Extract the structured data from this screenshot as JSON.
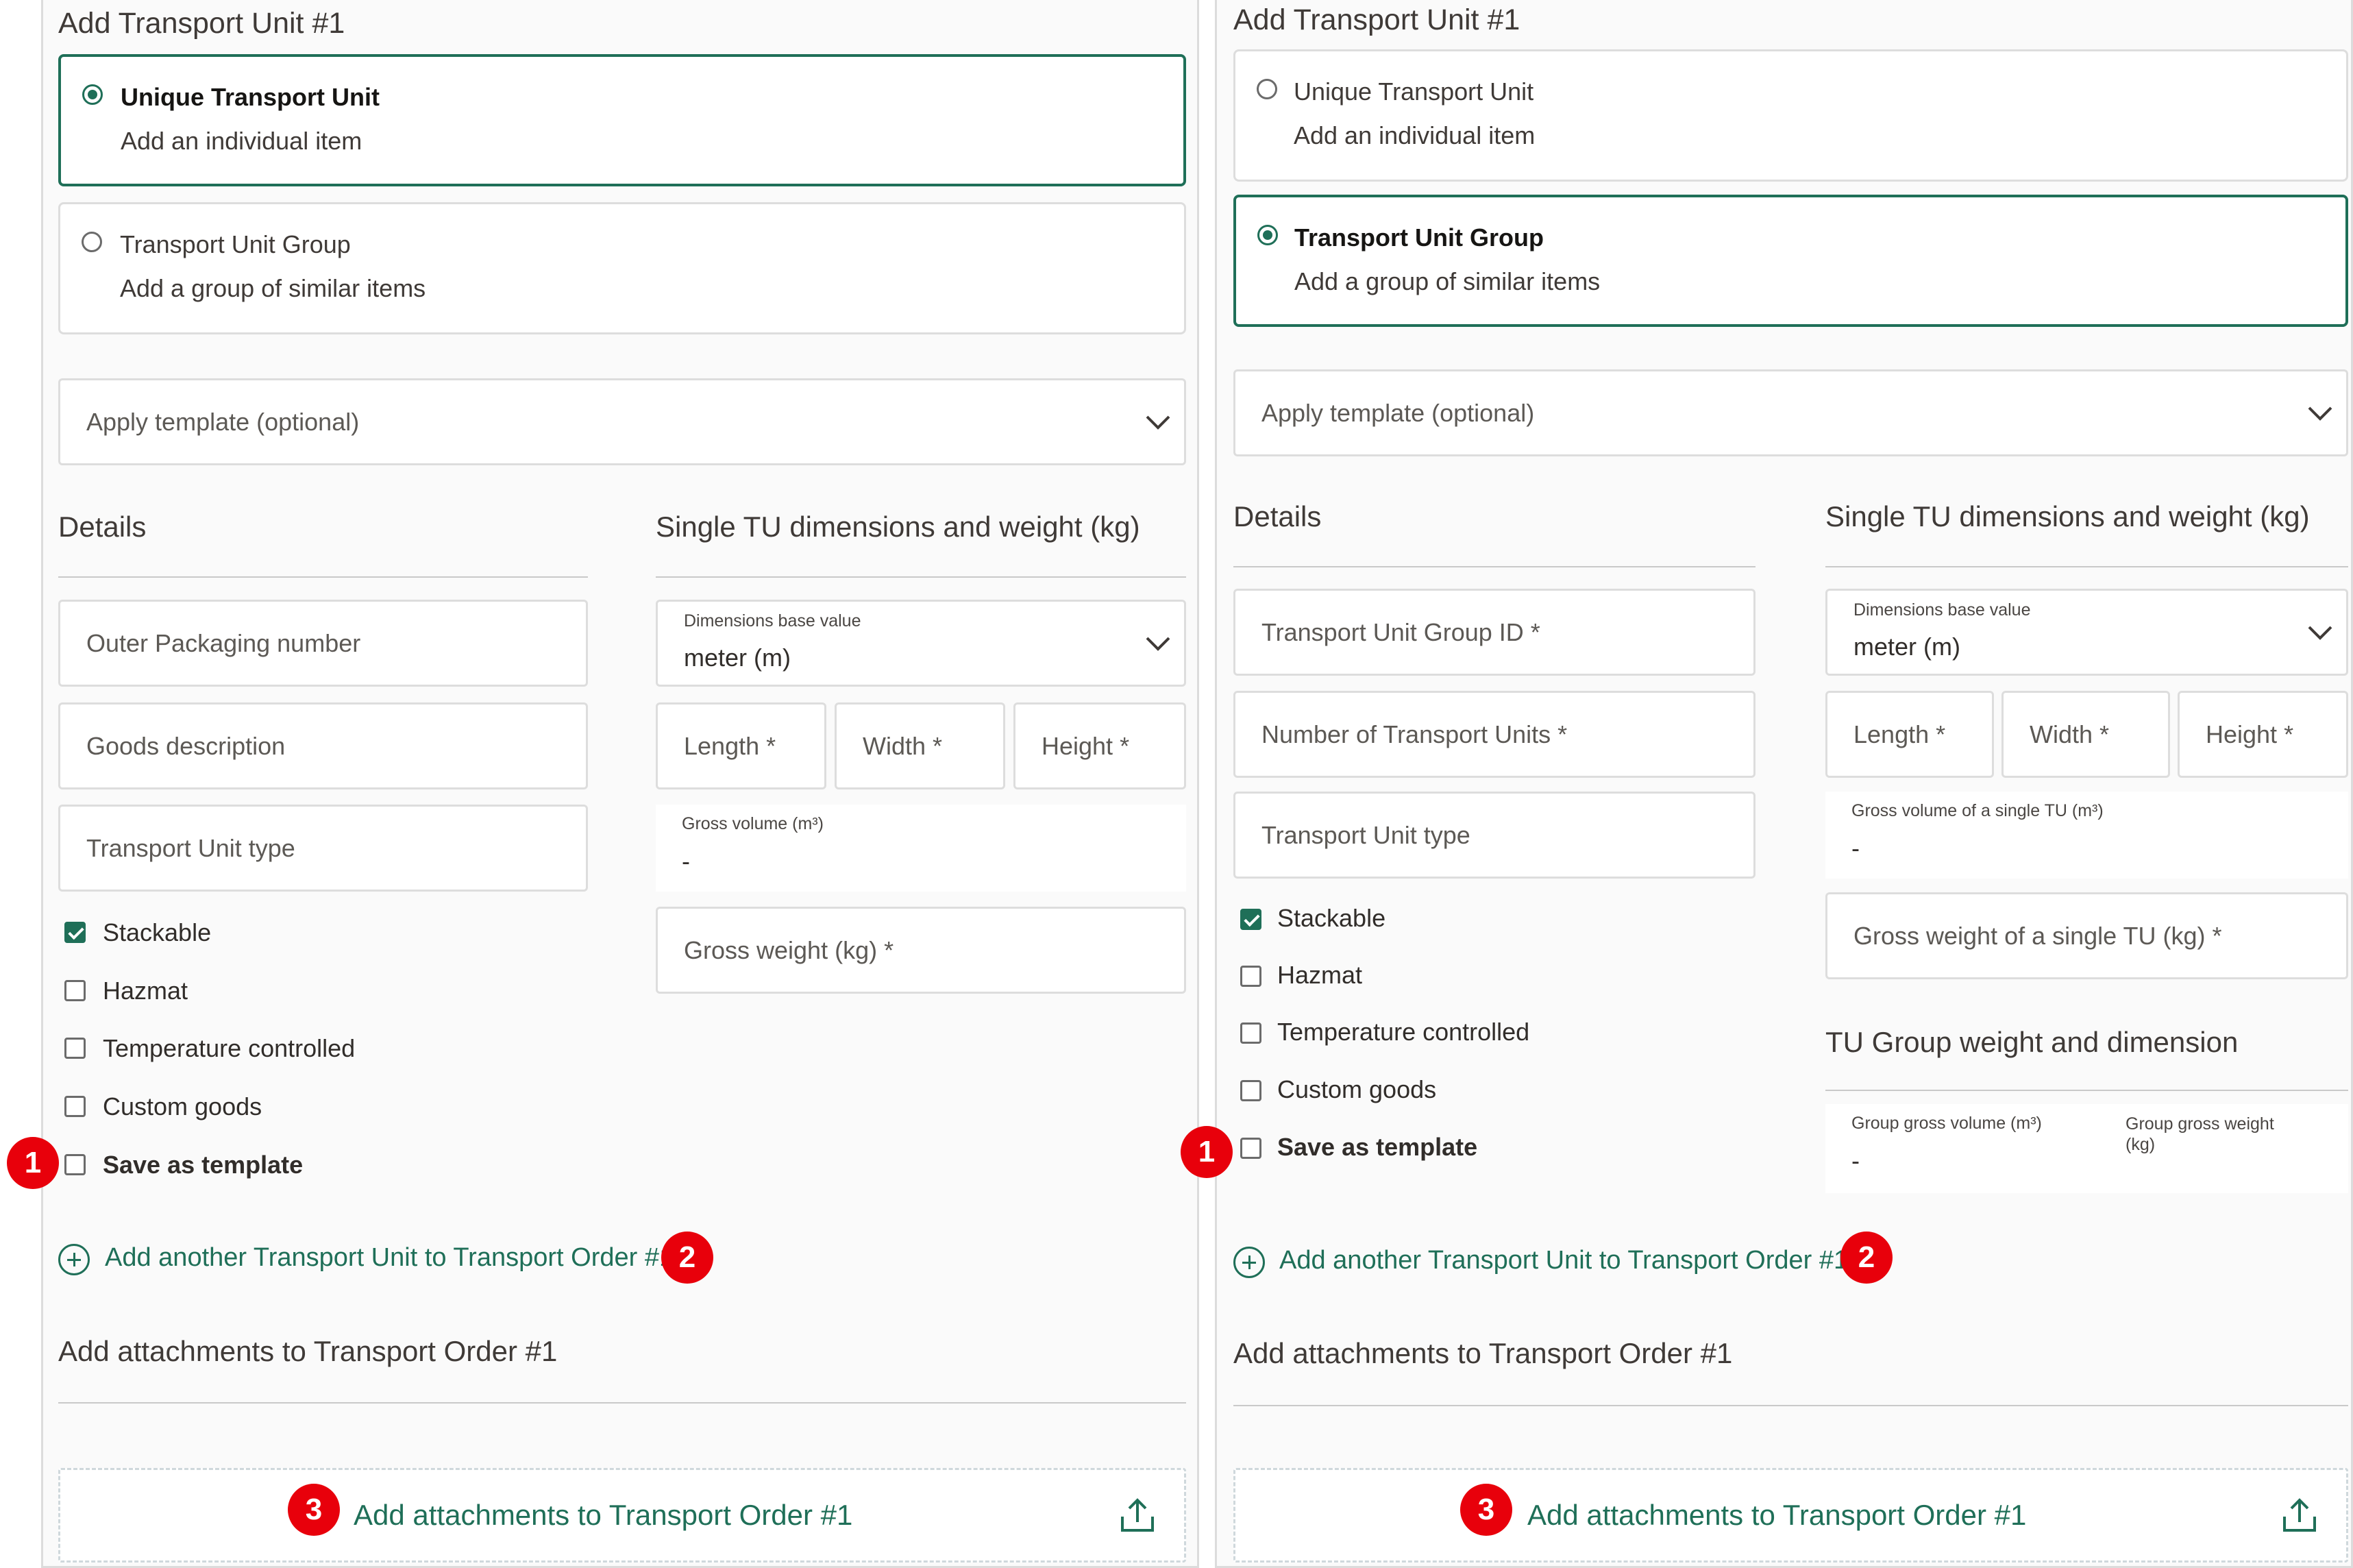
{
  "colors": {
    "accent": "#1f6f58",
    "badge": "#e8000b"
  },
  "icons": {
    "add": "plus-circle-icon",
    "upload": "upload-icon",
    "dropdown": "chevron-down-icon"
  },
  "left": {
    "title": "Add Transport Unit #1",
    "option_unique": {
      "title": "Unique Transport Unit",
      "desc": "Add an individual item",
      "selected": true
    },
    "option_group": {
      "title": "Transport Unit Group",
      "desc": "Add a group of similar items",
      "selected": false
    },
    "template_placeholder": "Apply template (optional)",
    "details_heading": "Details",
    "dims_heading": "Single TU dimensions and weight (kg)",
    "fields": [
      "Outer Packaging number",
      "Goods description",
      "Transport Unit type"
    ],
    "dim_base_label": "Dimensions base value",
    "dim_base_value": "meter (m)",
    "length": "Length *",
    "width": "Width *",
    "height": "Height *",
    "gross_volume_label": "Gross volume (m³)",
    "gross_volume_value": "-",
    "gross_weight": "Gross weight (kg) *",
    "checkboxes": [
      {
        "label": "Stackable",
        "checked": true
      },
      {
        "label": "Hazmat",
        "checked": false
      },
      {
        "label": "Temperature controlled",
        "checked": false
      },
      {
        "label": "Custom goods",
        "checked": false
      }
    ],
    "save_template": "Save as template",
    "add_another": "Add another Transport Unit to Transport Order #1",
    "attachments_heading": "Add attachments to Transport Order #1",
    "attachments_button": "Add attachments to Transport Order #1"
  },
  "right": {
    "title": "Add Transport Unit #1",
    "option_unique": {
      "title": "Unique Transport Unit",
      "desc": "Add an individual item",
      "selected": false
    },
    "option_group": {
      "title": "Transport Unit Group",
      "desc": "Add a group of similar items",
      "selected": true
    },
    "template_placeholder": "Apply template (optional)",
    "details_heading": "Details",
    "dims_heading": "Single TU dimensions and weight (kg)",
    "fields": [
      "Transport Unit Group ID *",
      "Number of Transport Units *",
      "Transport Unit type"
    ],
    "dim_base_label": "Dimensions base value",
    "dim_base_value": "meter (m)",
    "length": "Length *",
    "width": "Width *",
    "height": "Height *",
    "gross_volume_label": "Gross volume of a single TU (m³)",
    "gross_volume_value": "-",
    "gross_weight": "Gross weight of a single TU (kg) *",
    "group_heading": "TU Group weight and dimension",
    "group_volume_label": "Group gross volume (m³)",
    "group_volume_value": "-",
    "group_weight_label": "Group gross weight (kg)",
    "checkboxes": [
      {
        "label": "Stackable",
        "checked": true
      },
      {
        "label": "Hazmat",
        "checked": false
      },
      {
        "label": "Temperature controlled",
        "checked": false
      },
      {
        "label": "Custom goods",
        "checked": false
      }
    ],
    "save_template": "Save as template",
    "add_another": "Add another Transport Unit to Transport Order #1",
    "attachments_heading": "Add attachments to Transport Order #1",
    "attachments_button": "Add attachments to Transport Order #1"
  },
  "badges": [
    "1",
    "2",
    "3"
  ]
}
